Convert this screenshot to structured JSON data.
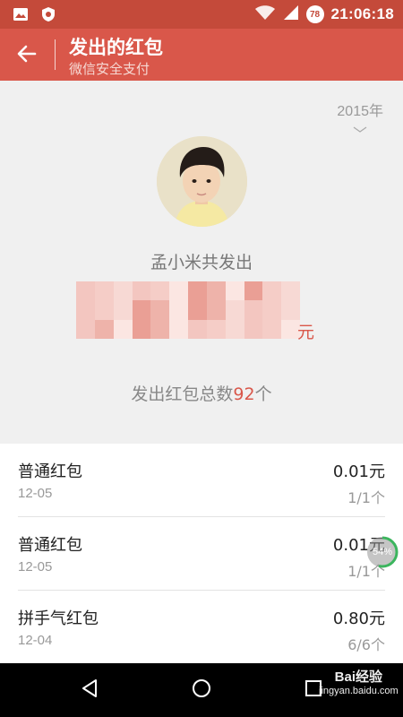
{
  "status_bar": {
    "time": "21:06:18",
    "notification_count": "78",
    "icons": [
      "image-icon",
      "shield-icon",
      "wifi-icon",
      "signal-icon"
    ]
  },
  "header": {
    "title": "发出的红包",
    "subtitle": "微信安全支付",
    "back_icon": "back-arrow-icon"
  },
  "summary": {
    "year": "2015年",
    "sender_text": "孟小米共发出",
    "amount_unit": "元",
    "count_prefix": "发出红包总数",
    "count_value": "92",
    "count_suffix": "个"
  },
  "packets": [
    {
      "type": "普通红包",
      "date": "12-05",
      "amount": "0.01元",
      "count": "1/1个"
    },
    {
      "type": "普通红包",
      "date": "12-05",
      "amount": "0.01元",
      "count": "1/1个"
    },
    {
      "type": "拼手气红包",
      "date": "12-04",
      "amount": "0.80元",
      "count": "6/6个"
    }
  ],
  "floating_progress": {
    "label": "54%",
    "value": 0.54,
    "color": "#3cb55e"
  },
  "watermark": {
    "main": "Bai经验",
    "sub": "jingyan.baidu.com"
  },
  "colors": {
    "accent": "#d9574a",
    "status_bar": "#c44a3a"
  }
}
